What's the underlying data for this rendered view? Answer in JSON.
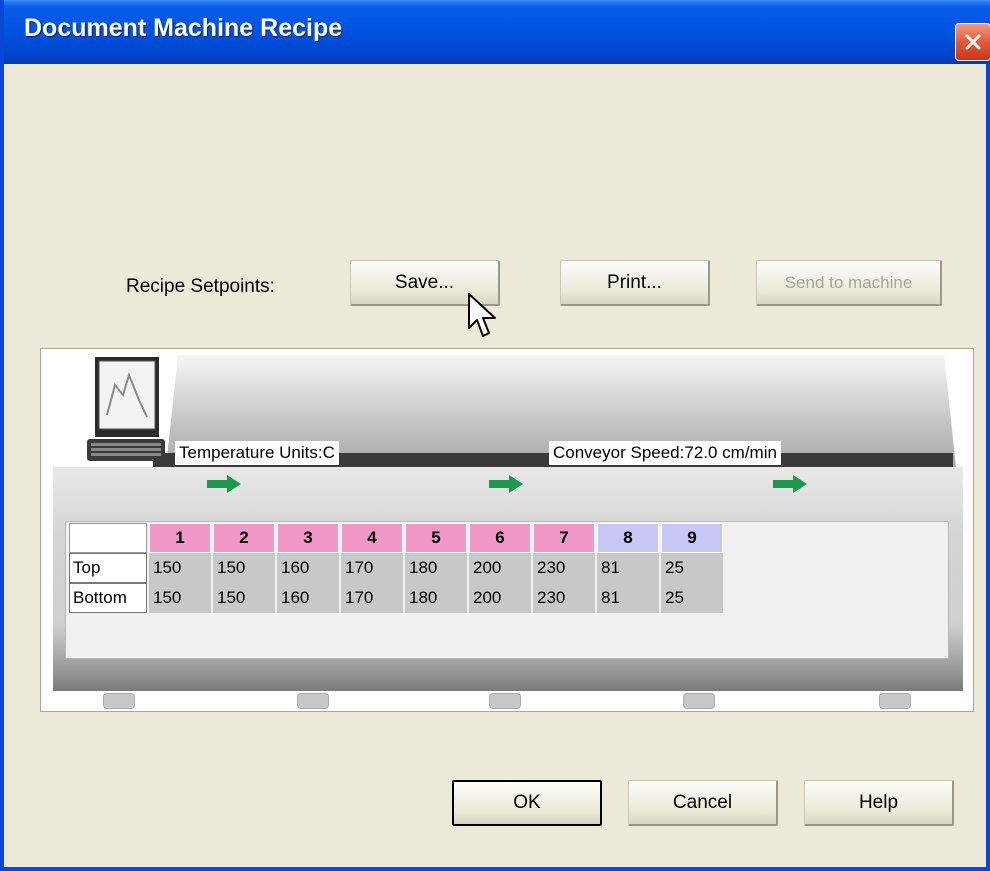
{
  "window": {
    "title": "Document Machine Recipe"
  },
  "toolbar": {
    "recipe_label": "Recipe Setpoints:",
    "save_label": "Save...",
    "print_label": "Print...",
    "send_label": "Send to machine"
  },
  "oven": {
    "temperature_units": "Temperature Units:C",
    "conveyor_speed": "Conveyor Speed:72.0  cm/min"
  },
  "zones": {
    "headers": [
      "1",
      "2",
      "3",
      "4",
      "5",
      "6",
      "7",
      "8",
      "9"
    ],
    "header_colors": [
      "#f099c9",
      "#f099c9",
      "#f099c9",
      "#f099c9",
      "#f099c9",
      "#f099c9",
      "#f099c9",
      "#c8c6f4",
      "#c8c6f4"
    ],
    "rows": [
      {
        "label": "Top",
        "values": [
          "150",
          "150",
          "160",
          "170",
          "180",
          "200",
          "230",
          "81",
          "25"
        ]
      },
      {
        "label": "Bottom",
        "values": [
          "150",
          "150",
          "160",
          "170",
          "180",
          "200",
          "230",
          "81",
          "25"
        ]
      }
    ]
  },
  "footer": {
    "ok_label": "OK",
    "cancel_label": "Cancel",
    "help_label": "Help"
  },
  "colors": {
    "titlebar": "#0054e3",
    "dialog_bg": "#ece9d8",
    "accent_arrow": "#1a9a4a"
  }
}
